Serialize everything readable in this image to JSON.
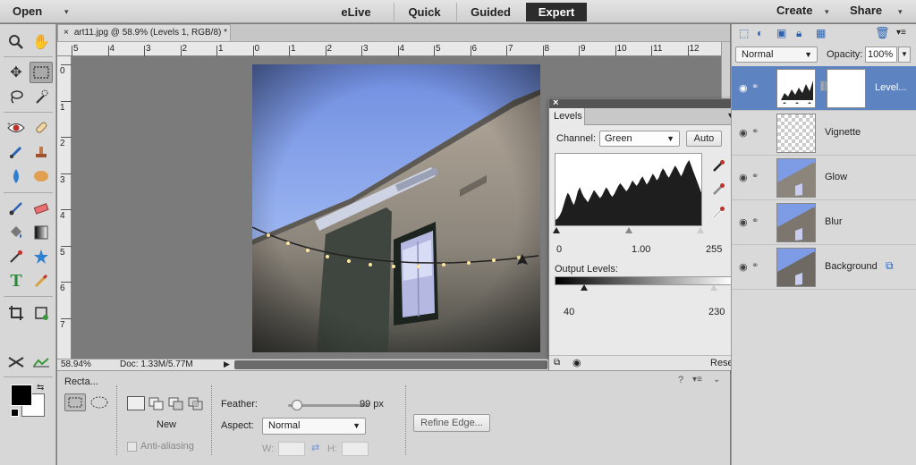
{
  "topbar": {
    "open_label": "Open",
    "modes": [
      "eLive",
      "Quick",
      "Guided",
      "Expert"
    ],
    "active_mode": "Expert",
    "create_label": "Create",
    "share_label": "Share"
  },
  "document": {
    "tab_title": "art11.jpg @ 58.9% (Levels 1, RGB/8) *",
    "close_glyph": "×",
    "zoom": "58.94%",
    "doc_info": "Doc: 1.33M/5.77M",
    "ruler_top_labels": [
      "5",
      "4",
      "3",
      "2",
      "1",
      "0",
      "1",
      "2",
      "3",
      "4",
      "5",
      "6",
      "7",
      "8",
      "9",
      "10",
      "11",
      "12"
    ],
    "ruler_left_labels": [
      "0",
      "1",
      "2",
      "3",
      "4",
      "5",
      "6",
      "7"
    ]
  },
  "levels": {
    "tab_label": "Levels",
    "channel_label": "Channel:",
    "channel_value": "Green",
    "auto_label": "Auto",
    "input_black": "0",
    "input_gamma": "1.00",
    "input_white": "255",
    "output_label": "Output Levels:",
    "output_black": "40",
    "output_white": "230",
    "reset_label": "Reset",
    "histogram": [
      8,
      10,
      14,
      20,
      30,
      40,
      48,
      44,
      36,
      30,
      38,
      50,
      56,
      48,
      42,
      38,
      34,
      40,
      46,
      52,
      48,
      44,
      40,
      44,
      50,
      56,
      52,
      46,
      42,
      46,
      52,
      58,
      62,
      58,
      54,
      50,
      54,
      60,
      66,
      62,
      58,
      62,
      68,
      72,
      66,
      60,
      64,
      70,
      76,
      72,
      66,
      70,
      78,
      84,
      80,
      74,
      70,
      76,
      82,
      88,
      84,
      78,
      72,
      78,
      86,
      92,
      96,
      88,
      80,
      72,
      64,
      56,
      48
    ]
  },
  "layers": {
    "blend_mode": "Normal",
    "opacity_label": "Opacity:",
    "opacity_value": "100%",
    "items": [
      {
        "name": "Level...",
        "selected": true
      },
      {
        "name": "Vignette",
        "selected": false
      },
      {
        "name": "Glow",
        "selected": false
      },
      {
        "name": "Blur",
        "selected": false
      },
      {
        "name": "Background",
        "selected": false
      }
    ]
  },
  "options": {
    "tool_name": "Recta...",
    "new_label": "New",
    "feather_label": "Feather:",
    "feather_value": "99 px",
    "aspect_label": "Aspect:",
    "aspect_value": "Normal",
    "w_label": "W:",
    "h_label": "H:",
    "antialias_label": "Anti-aliasing",
    "refine_label": "Refine Edge..."
  },
  "colors": {
    "foreground": "#000000",
    "background": "#ffffff",
    "active_mode_bg": "#2c2c2c",
    "layer_selected": "#5d84c0"
  }
}
